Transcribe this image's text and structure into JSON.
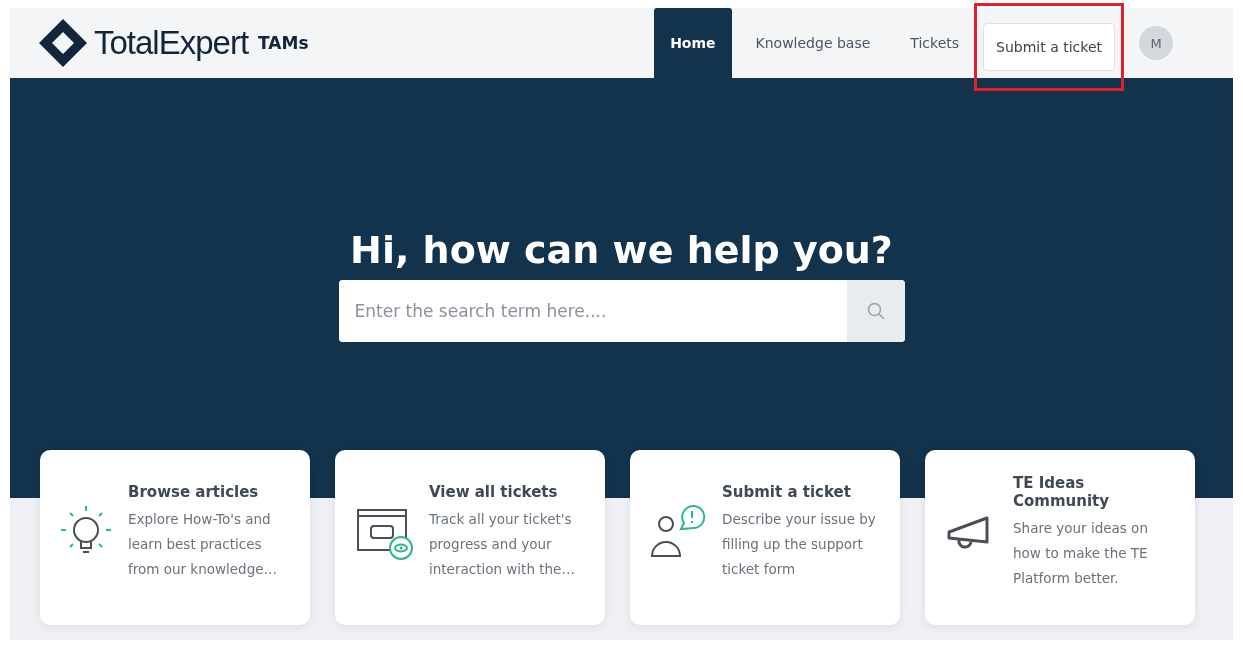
{
  "header": {
    "logo": {
      "name": "TotalExpert",
      "suffix": "TAMs"
    },
    "nav": [
      {
        "label": "Home",
        "selected": true,
        "kind": "tab",
        "highlighted": false
      },
      {
        "label": "Knowledge base",
        "selected": false,
        "kind": "tab",
        "highlighted": false
      },
      {
        "label": "Tickets",
        "selected": false,
        "kind": "tab",
        "highlighted": false
      },
      {
        "label": "Submit a ticket",
        "selected": false,
        "kind": "button",
        "highlighted": true
      }
    ],
    "avatar": "M"
  },
  "hero": {
    "title": "Hi, how can we help you?",
    "search": {
      "placeholder": "Enter the search term here...."
    }
  },
  "cards": [
    {
      "kind": "bulb",
      "title": "Browse articles",
      "text": "Explore How-To's and learn best practices from our knowledge…"
    },
    {
      "kind": "ticket",
      "title": "View all tickets",
      "text": "Track all your ticket's progress and your interaction with the…"
    },
    {
      "kind": "person",
      "title": "Submit a ticket",
      "text": "Describe your issue by filling up the support ticket form"
    },
    {
      "kind": "megaphone",
      "title": "TE Ideas Community",
      "text": "Share your ideas on how to make the TE Platform better."
    }
  ]
}
